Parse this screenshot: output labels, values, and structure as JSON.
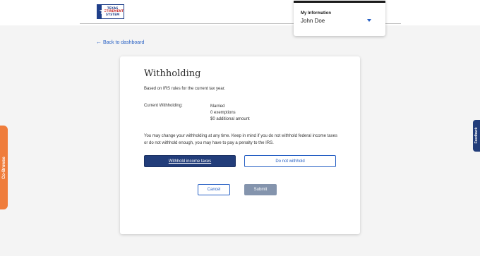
{
  "logo": {
    "lines": [
      "TEXAS",
      "RETIREMENT",
      "SYSTEM"
    ],
    "star_glyph": "★",
    "colors": {
      "navy": "#1f3f8a",
      "red": "#c62828"
    }
  },
  "account": {
    "label": "My Information",
    "name": "John Doe"
  },
  "nav": {
    "back_arrow": "←",
    "back_label": "Back to dashboard"
  },
  "withholding": {
    "title": "Withholding",
    "subtitle": "Based on IRS rules for the current tax year.",
    "current_label": "Current Withholding:",
    "status": "Married",
    "exemptions": "0 exemptions",
    "additional": "$0 additional amount",
    "notice": "You may change your withholding at any time. Keep in mind if you do not withhold federal income taxes or do not withhold enough, you may have to pay a penalty to the IRS."
  },
  "buttons": {
    "withhold": "Withhold income taxes",
    "no_withhold": "Do not withhold",
    "cancel": "Cancel",
    "submit": "Submit"
  },
  "side_tabs": {
    "cobrowse": "Co-Browse",
    "feedback": "Feedback"
  },
  "colors": {
    "primary": "#223d7a",
    "link": "#2760c4",
    "submit_disabled": "#8494ad",
    "cobrowse": "#ef7d3c"
  }
}
